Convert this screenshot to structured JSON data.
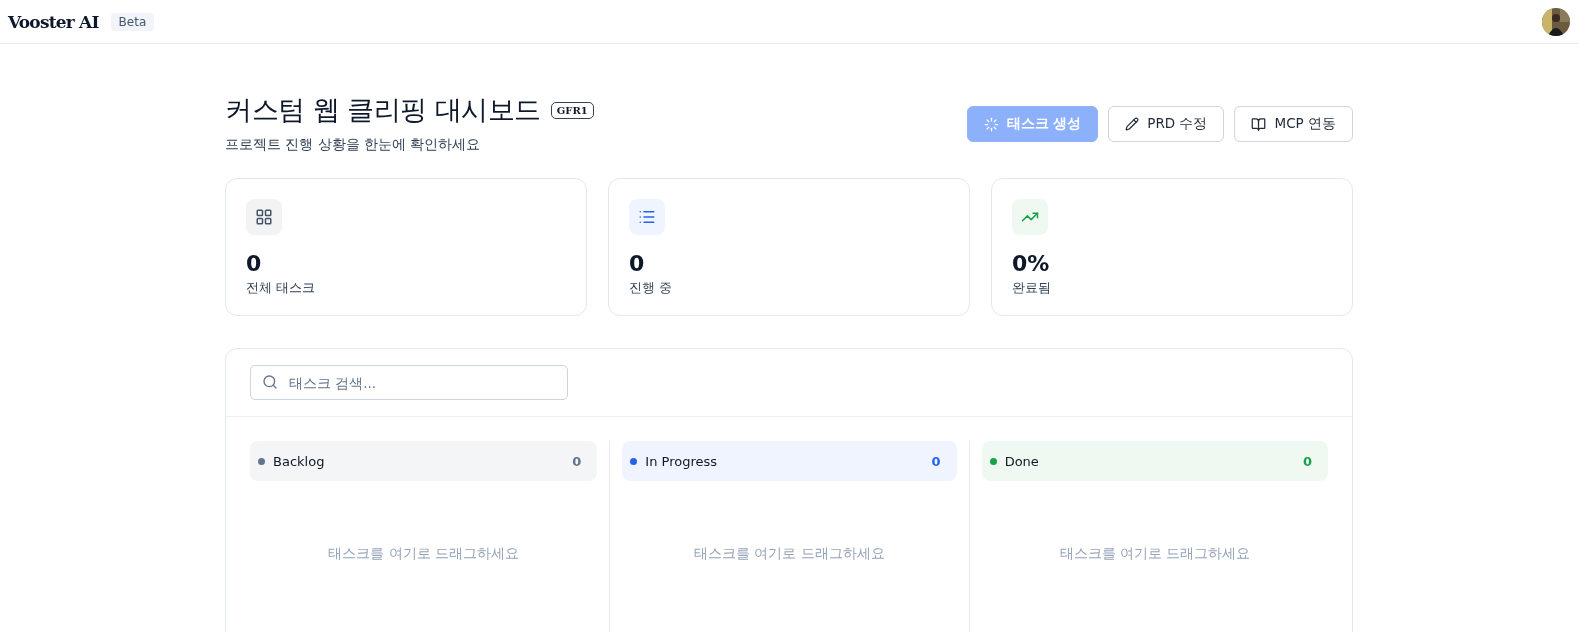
{
  "header": {
    "logo": "Vooster AI",
    "badge": "Beta"
  },
  "project": {
    "title": "커스텀 웹 클리핑 대시보드",
    "code": "GFR1",
    "subtitle": "프로젝트 진행 상황을 한눈에 확인하세요"
  },
  "actions": [
    {
      "kind": "primary",
      "label": "태스크 생성",
      "loading": true
    },
    {
      "kind": "edit",
      "label": "PRD 수정",
      "loading": false
    },
    {
      "kind": "book",
      "label": "MCP 연동",
      "loading": false
    }
  ],
  "stats": [
    {
      "kind": "grid",
      "value": "0",
      "label": "전체 태스크",
      "color": "#475569"
    },
    {
      "kind": "list",
      "value": "0",
      "label": "진행 중",
      "color": "#2563eb"
    },
    {
      "kind": "trend",
      "value": "0%",
      "label": "완료됨",
      "color": "#16a34a"
    }
  ],
  "search": {
    "placeholder": "태스크 검색..."
  },
  "columns": [
    {
      "name": "Backlog",
      "count": "0",
      "color": "#64748b",
      "empty": "태스크를 여기로 드래그하세요"
    },
    {
      "name": "In Progress",
      "count": "0",
      "color": "#2563eb",
      "empty": "태스크를 여기로 드래그하세요"
    },
    {
      "name": "Done",
      "count": "0",
      "color": "#16a34a",
      "empty": "태스크를 여기로 드래그하세요"
    }
  ]
}
